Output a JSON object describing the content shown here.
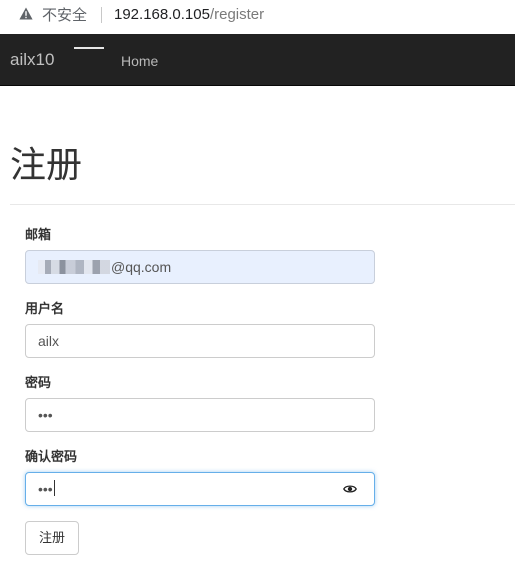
{
  "browser": {
    "security_label": "不安全",
    "url_host": "192.168.0.105",
    "url_path": "/register",
    "icons": {
      "warning": "warning-triangle-icon"
    }
  },
  "navbar": {
    "brand": "ailx10",
    "home": "Home"
  },
  "page": {
    "title": "注册"
  },
  "form": {
    "email_label": "邮箱",
    "email_value_visible": "@qq.com",
    "username_label": "用户名",
    "username_value": "ailx",
    "password_label": "密码",
    "password_value": "•••",
    "confirm_label": "确认密码",
    "confirm_value": "•••",
    "submit_label": "注册",
    "icons": {
      "reveal": "eye-icon"
    }
  },
  "colors": {
    "navbar_bg": "#222222",
    "autofill_bg": "#e8f0fe",
    "focus_border": "#66afe9"
  }
}
